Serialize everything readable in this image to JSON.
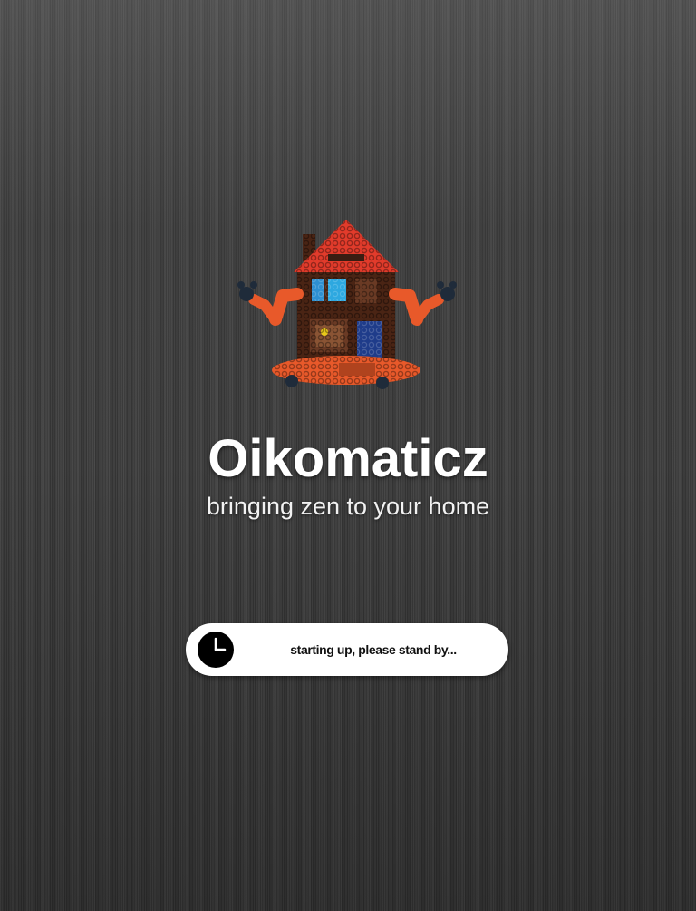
{
  "app": {
    "title": "Oikomaticz",
    "tagline": "bringing zen to your home"
  },
  "logo": {
    "icon": "meditating-house-mascot-icon"
  },
  "status": {
    "icon": "clock-icon",
    "text": "starting up, please stand by..."
  },
  "colors": {
    "roof": "#e23b2b",
    "body": "#4a2414",
    "limbs": "#e8592a",
    "window": "#2d8fd0",
    "door": "#1f3c8a",
    "pill_background": "#ffffff"
  }
}
